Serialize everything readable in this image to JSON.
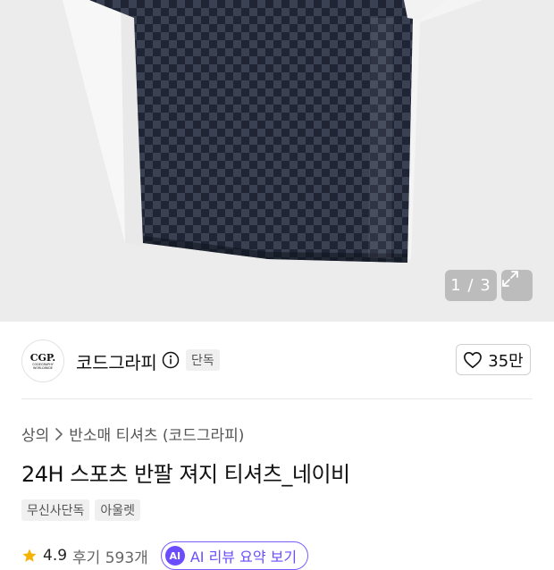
{
  "gallery": {
    "pager_text": "1 / 3",
    "expand_icon": "expand-icon",
    "image_alt_icon": "product-image"
  },
  "brand": {
    "logo_text": "CGP.",
    "logo_subtext": "CODEGRAPHY WORLDWIDE",
    "name": "코드그라피",
    "info_icon": "info-icon",
    "badge": "단독",
    "like_count": "35만",
    "like_icon": "heart-icon"
  },
  "breadcrumb": {
    "category": "상의",
    "separator_icon": "chevron-right-icon",
    "subcategory": "반소매 티셔츠 (코드그라피)"
  },
  "product": {
    "title": "24H 스포츠 반팔 져지 티셔츠_네이비",
    "tags": [
      "무신사단독",
      "아울렛"
    ]
  },
  "rating": {
    "star_icon": "star-icon",
    "score": "4.9",
    "reviews": "후기 593개",
    "summary_button": "AI 리뷰 요약 보기",
    "summary_icon_text": "AI"
  },
  "colors": {
    "accent": "#6b4dff",
    "star": "#f5b301",
    "shirt_navy": "#1f2535"
  }
}
